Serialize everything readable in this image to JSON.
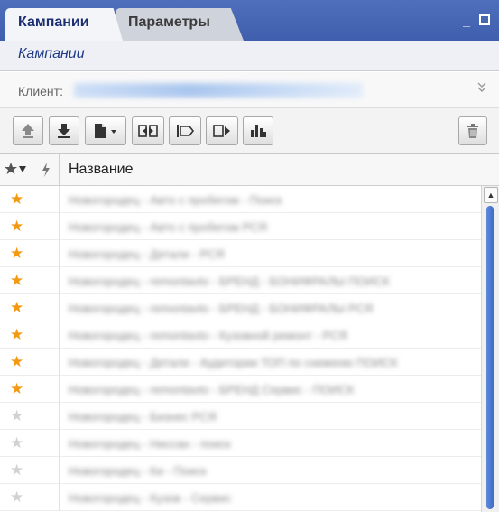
{
  "tabs": [
    {
      "label": "Кампании",
      "active": true
    },
    {
      "label": "Параметры",
      "active": false
    }
  ],
  "window_controls": {
    "minimize": "_",
    "maximize": "□"
  },
  "subtitle": "Кампании",
  "client": {
    "label": "Клиент:",
    "value_blurred": true
  },
  "toolbar": {
    "buttons": [
      "move-up-icon",
      "download-icon",
      "document-menu-icon",
      "split-columns-icon",
      "align-left-icon",
      "forward-icon",
      "bar-chart-icon",
      "trash-icon"
    ]
  },
  "columns": {
    "name": "Название"
  },
  "rows": [
    {
      "favorite": true,
      "name": "Новогородец - Авто с пробегом - Поиск"
    },
    {
      "favorite": true,
      "name": "Новогородец - Авто с пробегом РСЯ"
    },
    {
      "favorite": true,
      "name": "Новогородец - Детали - РСЯ"
    },
    {
      "favorite": true,
      "name": "Новогородец - remontavto - БРЕНД - БОНИФРАЛЫ ПОИСК"
    },
    {
      "favorite": true,
      "name": "Новогородец - remontavto - БРЕНД - БОНИФРАЛЫ РСЯ"
    },
    {
      "favorite": true,
      "name": "Новогородец - remontavto - Кузовной ремонт - РСЯ"
    },
    {
      "favorite": true,
      "name": "Новогородец - Детали - Аудитории ТОП по сниженю ПОИСК"
    },
    {
      "favorite": true,
      "name": "Новогородец - remontavto - БРЕНД Сервис - ПОИСК"
    },
    {
      "favorite": false,
      "name": "Новогородец - Бизнес РСЯ"
    },
    {
      "favorite": false,
      "name": "Новогородец - Ниссан - поиск"
    },
    {
      "favorite": false,
      "name": "Новогородец - Ки - Поиск"
    },
    {
      "favorite": false,
      "name": "Новогородец - Кузов - Сервис"
    }
  ],
  "colors": {
    "accent": "#3f5fae",
    "star_on": "#f39a12",
    "star_off": "#d2d2d2",
    "scroll": "#4a78cf"
  }
}
